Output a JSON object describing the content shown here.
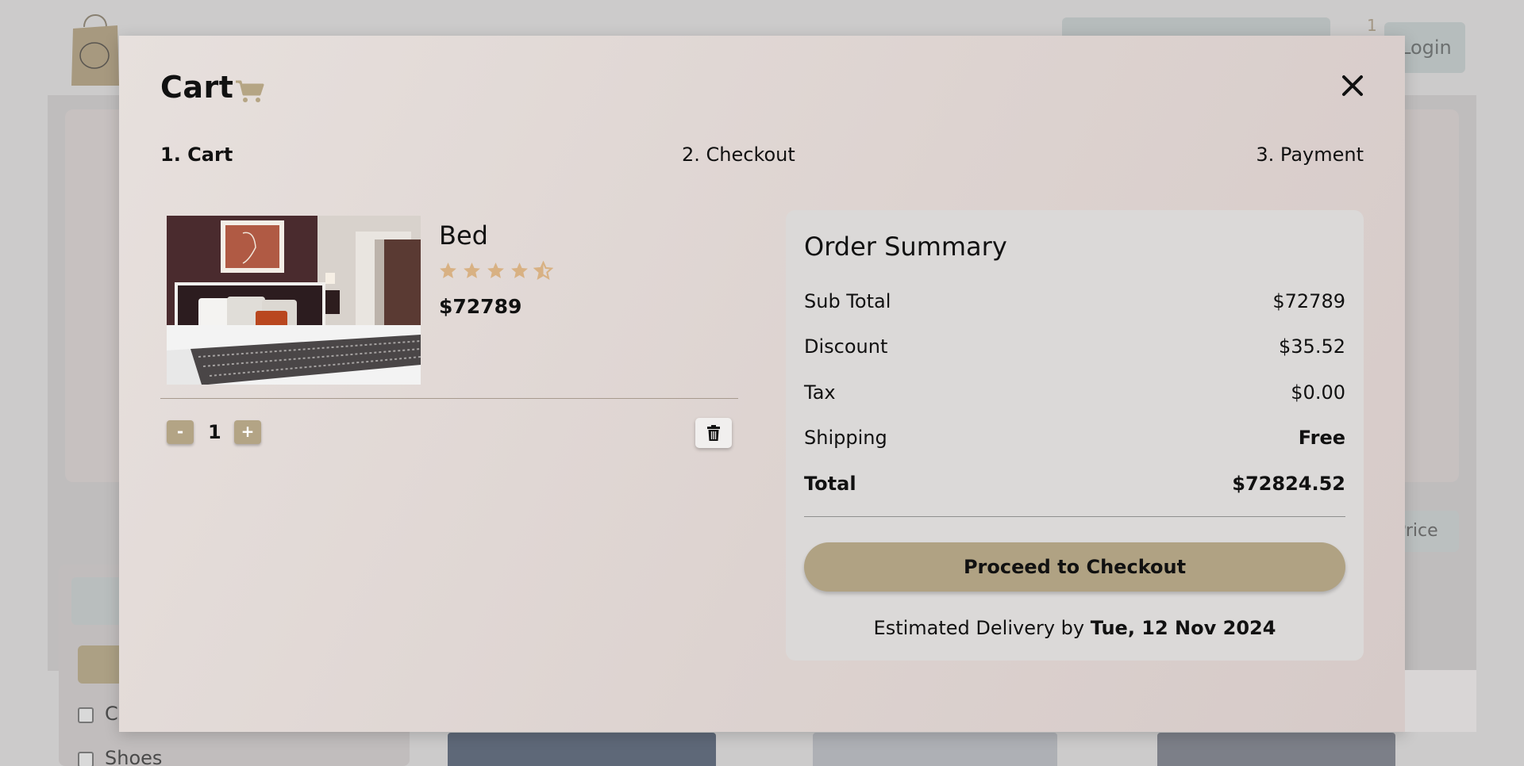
{
  "background": {
    "cart_count": "1",
    "login_label": "Login",
    "sort_label": "Price",
    "filter_items": [
      "C",
      "Shoes"
    ]
  },
  "cart": {
    "title": "Cart",
    "steps": [
      "1. Cart",
      "2. Checkout",
      "3. Payment"
    ],
    "item": {
      "name": "Bed",
      "rating": 4.5,
      "price": "$72789",
      "quantity": "1",
      "minus_label": "-",
      "plus_label": "+"
    },
    "summary": {
      "title": "Order Summary",
      "rows": [
        {
          "label": "Sub Total",
          "value": "$72789"
        },
        {
          "label": "Discount",
          "value": "$35.52"
        },
        {
          "label": "Tax",
          "value": "$0.00"
        },
        {
          "label": "Shipping",
          "value": "Free"
        },
        {
          "label": "Total",
          "value": "$72824.52"
        }
      ],
      "checkout_label": "Proceed to Checkout",
      "delivery_prefix": "Estimated Delivery by",
      "delivery_date": "Tue, 12 Nov 2024"
    }
  },
  "colors": {
    "accent": "#b0a283",
    "star": "#d8b183"
  },
  "icons": [
    "cart-icon",
    "close-icon",
    "star-icon",
    "trash-icon"
  ]
}
